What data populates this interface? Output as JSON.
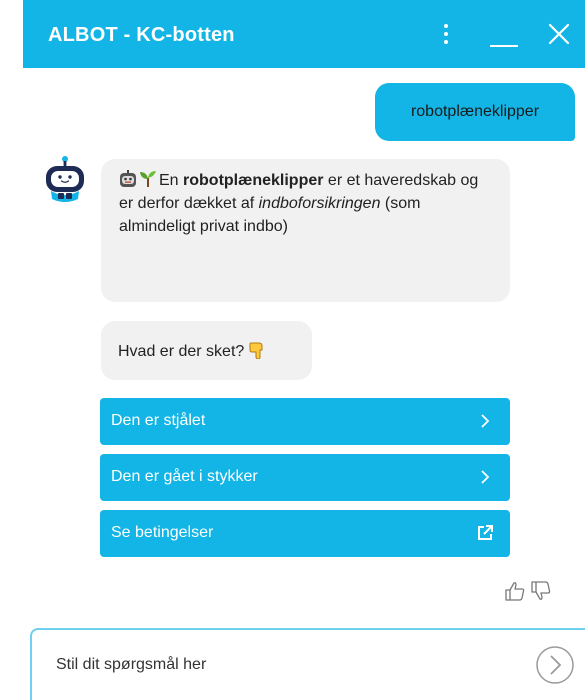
{
  "header": {
    "title": "ALBOT - KC-botten"
  },
  "messages": {
    "user_text": "robotplæneklipper",
    "bot1": {
      "intro": "En ",
      "bold": "robotplæneklipper",
      "mid": " er et haveredskab og er derfor dækket af ",
      "italic": "indboforsikringen",
      "end": " (som almindeligt privat indbo)"
    },
    "bot2": {
      "text": "Hvad er der sket? "
    }
  },
  "quick_replies": [
    {
      "label": "Den er stjålet",
      "icon": "chevron-right-icon"
    },
    {
      "label": "Den er gået i stykker",
      "icon": "chevron-right-icon"
    },
    {
      "label": "Se betingelser",
      "icon": "external-link-icon"
    }
  ],
  "composer": {
    "placeholder": "Stil dit spørgsmål her"
  },
  "colors": {
    "brand": "#12b5e5",
    "bubble_bg": "#f1f1f1",
    "avatar_navy": "#1d2b55"
  }
}
